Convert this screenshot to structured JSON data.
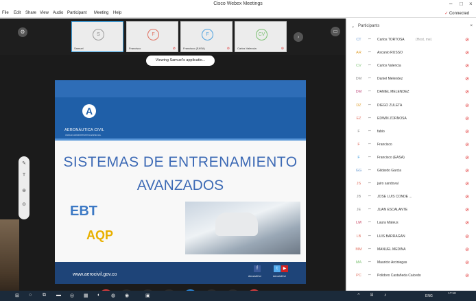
{
  "window": {
    "title": "Cisco Webex Meetings",
    "connected": "Connected"
  },
  "menu": [
    "File",
    "Edit",
    "Share",
    "View",
    "Audio",
    "Participant",
    "Meeting",
    "Help"
  ],
  "thumbnails": [
    {
      "initial": "S",
      "name": "Samuel",
      "color": "#9a9a9a",
      "active": true
    },
    {
      "initial": "F",
      "name": "Francisco",
      "color": "#e07060",
      "active": false
    },
    {
      "initial": "F",
      "name": "Francisco (EASA)",
      "color": "#4aa0e0",
      "active": false
    },
    {
      "initial": "CV",
      "name": "Carlos Valencia",
      "color": "#7ac070",
      "active": false
    }
  ],
  "viewing_banner": "Viewing Samuel's applicatio...",
  "slide": {
    "org_name": "AERONÁUTICA CIVIL",
    "org_sub": "UNIDAD ADMINISTRATIVA ESPECIAL",
    "heading_line1": "SISTEMAS DE ENTRENAMIENTO",
    "heading_line2": "AVANZADOS",
    "item1": "EBT",
    "item2": "AQP",
    "url": "www.aerocivil.gov.co",
    "social1": "AerocivilCol",
    "social2": "AerocivilCol"
  },
  "participants_panel": {
    "title": "Participants",
    "rows": [
      {
        "initials": "CT",
        "name": "Carlos TORTOSA",
        "extra": "(Host, me)",
        "color": "#6a9ad0"
      },
      {
        "initials": "AR",
        "name": "Ascanio RUSSO",
        "color": "#e0a030"
      },
      {
        "initials": "CV",
        "name": "Carlos Valencia",
        "color": "#7ac070"
      },
      {
        "initials": "DM",
        "name": "Daniel Melendez",
        "color": "#888888"
      },
      {
        "initials": "DM",
        "name": "DANIEL MELENDEZ",
        "color": "#c05080"
      },
      {
        "initials": "DZ",
        "name": "DIEGO ZULETA",
        "color": "#e0a030"
      },
      {
        "initials": "EZ",
        "name": "EDWIN ZORNOSA",
        "color": "#e07060"
      },
      {
        "initials": "F",
        "name": "fabio",
        "color": "#888888"
      },
      {
        "initials": "F",
        "name": "Francisco",
        "color": "#e07060"
      },
      {
        "initials": "F",
        "name": "Francisco (EASA)",
        "color": "#4aa0e0"
      },
      {
        "initials": "GG",
        "name": "Gildardo Garcia",
        "color": "#6a9ad0"
      },
      {
        "initials": "JS",
        "name": "jairo sandoval",
        "color": "#e07060"
      },
      {
        "initials": "JB",
        "name": "JOSE LUIS CONDE ...",
        "color": "#888888"
      },
      {
        "initials": "JE",
        "name": "JUAN ESCALANTE",
        "color": "#888888"
      },
      {
        "initials": "LM",
        "name": "Laura Mateus",
        "color": "#c03050"
      },
      {
        "initials": "LB",
        "name": "LUIS BARRAGAN",
        "color": "#e07060"
      },
      {
        "initials": "MM",
        "name": "MANUEL MEDINA",
        "color": "#e07060"
      },
      {
        "initials": "MA",
        "name": "Mauricio Arciniegas",
        "color": "#7ac070"
      },
      {
        "initials": "PC",
        "name": "Polidoro Castañeda Caicedo",
        "color": "#e07060"
      }
    ]
  },
  "taskbar": {
    "lang": "ENG",
    "time": "17:10"
  }
}
